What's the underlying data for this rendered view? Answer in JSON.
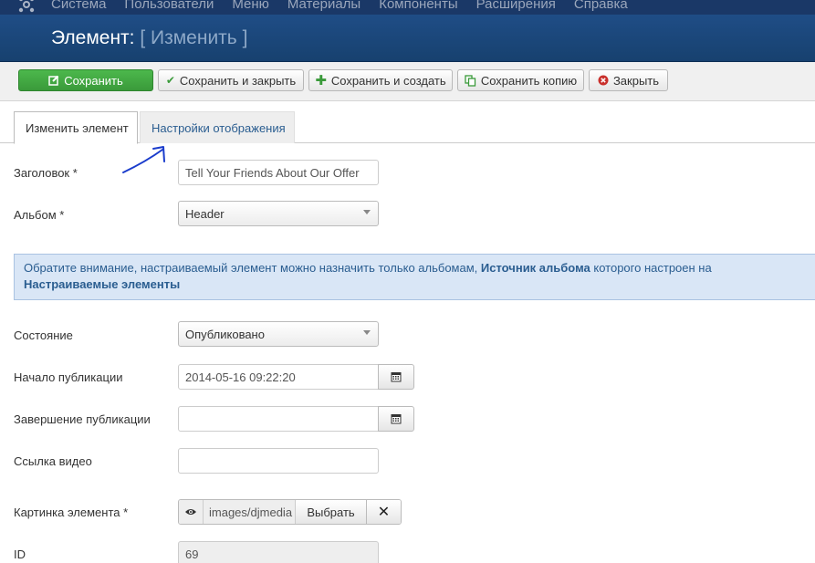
{
  "topmenu": {
    "items": [
      "Система",
      "Пользователи",
      "Меню",
      "Материалы",
      "Компоненты",
      "Расширения",
      "Справка"
    ]
  },
  "header": {
    "title": "Элемент:",
    "subtitle": "[ Изменить ]"
  },
  "toolbar": {
    "save": "Сохранить",
    "save_close": "Сохранить и закрыть",
    "save_new": "Сохранить и создать",
    "save_copy": "Сохранить копию",
    "close": "Закрыть"
  },
  "tabs": {
    "edit": "Изменить элемент",
    "display": "Настройки отображения"
  },
  "form": {
    "title_label": "Заголовок *",
    "title_value": "Tell Your Friends About Our Offer",
    "album_label": "Альбом *",
    "album_value": "Header",
    "notice_pre": "Обратите внимание, настраиваемый элемент можно назначить только альбомам,",
    "notice_bold1": "Источник альбома",
    "notice_mid": "которого настроен на",
    "notice_bold2": "Настраиваемые элементы",
    "state_label": "Состояние",
    "state_value": "Опубликовано",
    "publish_up_label": "Начало публикации",
    "publish_up_value": "2014-05-16 09:22:20",
    "publish_down_label": "Завершение публикации",
    "publish_down_value": "",
    "video_label": "Ссылка видео",
    "video_value": "",
    "image_label": "Картинка элемента *",
    "image_value": "images/djmedia",
    "image_choose": "Выбрать",
    "id_label": "ID",
    "id_value": "69"
  },
  "colors": {
    "topbar": "#1a3867",
    "titlebar": "#1f4d86",
    "save_green": "#46a546",
    "notice_bg": "#d9e6f6",
    "link_blue": "#2a5d90",
    "annotation": "#1a3ccc"
  },
  "icons": {
    "save": "edit-icon",
    "save_close": "check-icon",
    "save_new": "plus-icon",
    "save_copy": "copy-icon",
    "close": "close-circle-icon",
    "calendar": "calendar-icon",
    "preview": "eye-icon",
    "clear": "x-icon"
  }
}
